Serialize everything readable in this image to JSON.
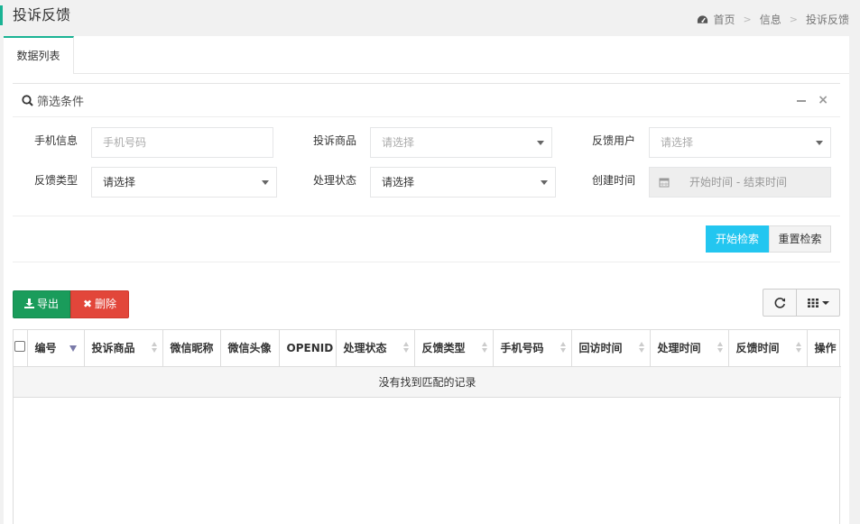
{
  "header": {
    "title": "投诉反馈",
    "breadcrumb": [
      "首页",
      "信息",
      "投诉反馈"
    ]
  },
  "tabs": [
    {
      "label": "数据列表"
    }
  ],
  "filter": {
    "title": "筛选条件",
    "fields": {
      "phone": {
        "label": "手机信息",
        "placeholder": "手机号码"
      },
      "product": {
        "label": "投诉商品",
        "value": "请选择"
      },
      "user": {
        "label": "反馈用户",
        "value": "请选择"
      },
      "type": {
        "label": "反馈类型",
        "value": "请选择"
      },
      "status": {
        "label": "处理状态",
        "value": "请选择"
      },
      "created": {
        "label": "创建时间",
        "placeholder": "开始时间 - 结束时间"
      }
    },
    "search_label": "开始检索",
    "reset_label": "重置检索"
  },
  "toolbar": {
    "export_label": "导出",
    "delete_label": "删除"
  },
  "table": {
    "columns": [
      "编号",
      "投诉商品",
      "微信昵称",
      "微信头像",
      "OPENID",
      "处理状态",
      "反馈类型",
      "手机号码",
      "回访时间",
      "处理时间",
      "反馈时间",
      "操作"
    ],
    "empty_text": "没有找到匹配的记录"
  },
  "colors": {
    "accent": "#1ab394",
    "search_button": "#23c6f0",
    "export_button": "#1a9c5b",
    "delete_button": "#e2463a"
  }
}
